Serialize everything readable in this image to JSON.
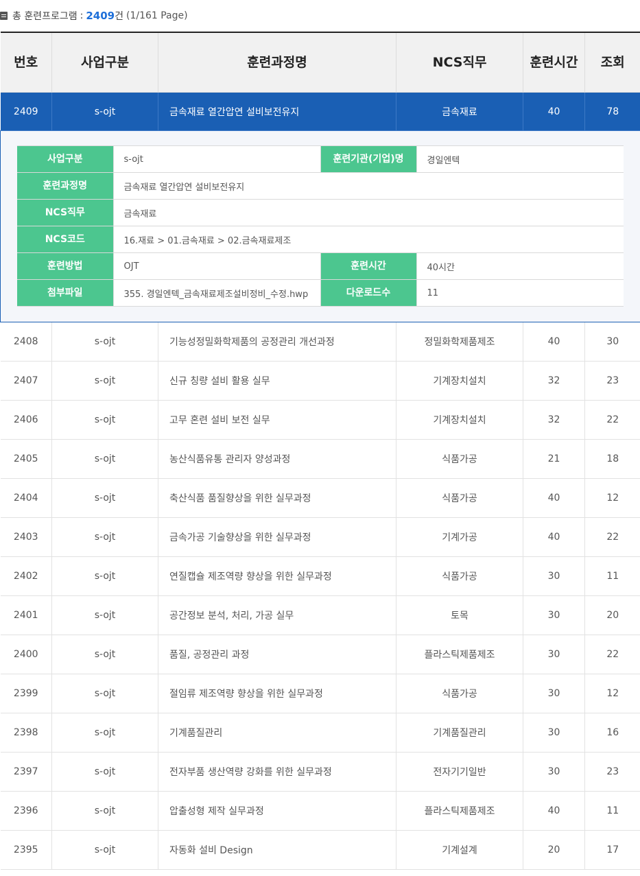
{
  "summary": {
    "label": "총 훈련프로그램",
    "separator": ":",
    "count": "2409",
    "unit": "건",
    "page_info": "(1/161 Page)"
  },
  "table": {
    "headers": {
      "no": "번호",
      "biz": "사업구분",
      "course": "훈련과정명",
      "ncs": "NCS직무",
      "hours": "훈련시간",
      "views": "조회"
    },
    "selected_row": {
      "no": "2409",
      "biz": "s-ojt",
      "course": "금속재료 열간압연 설비보전유지",
      "ncs": "금속재료",
      "hours": "40",
      "views": "78"
    },
    "detail": {
      "biz_label": "사업구분",
      "biz_value": "s-ojt",
      "org_label": "훈련기관(기업)명",
      "org_value": "경일엔텍",
      "course_label": "훈련과정명",
      "course_value": "금속재료 열간압연 설비보전유지",
      "ncs_job_label": "NCS직무",
      "ncs_job_value": "금속재료",
      "ncs_code_label": "NCS코드",
      "ncs_code_value": "16.재료 > 01.금속재료 > 02.금속재료제조",
      "method_label": "훈련방법",
      "method_value": "OJT",
      "hours_label": "훈련시간",
      "hours_value": "40시간",
      "file_label": "첨부파일",
      "file_value": "355. 경일엔텍_금속재료제조설비정비_수정.hwp",
      "downloads_label": "다운로드수",
      "downloads_value": "11"
    },
    "rows": [
      {
        "no": "2408",
        "biz": "s-ojt",
        "course": "기능성정밀화학제품의 공정관리 개선과정",
        "ncs": "정밀화학제품제조",
        "hours": "40",
        "views": "30"
      },
      {
        "no": "2407",
        "biz": "s-ojt",
        "course": "신규 칭량 설비 활용 실무",
        "ncs": "기계장치설치",
        "hours": "32",
        "views": "23"
      },
      {
        "no": "2406",
        "biz": "s-ojt",
        "course": "고무 혼련 설비 보전 실무",
        "ncs": "기계장치설치",
        "hours": "32",
        "views": "22"
      },
      {
        "no": "2405",
        "biz": "s-ojt",
        "course": "농산식품유통 관리자 양성과정",
        "ncs": "식품가공",
        "hours": "21",
        "views": "18"
      },
      {
        "no": "2404",
        "biz": "s-ojt",
        "course": "축산식품 품질향상을 위한 실무과정",
        "ncs": "식품가공",
        "hours": "40",
        "views": "12"
      },
      {
        "no": "2403",
        "biz": "s-ojt",
        "course": "금속가공 기술향상을 위한 실무과정",
        "ncs": "기계가공",
        "hours": "40",
        "views": "22"
      },
      {
        "no": "2402",
        "biz": "s-ojt",
        "course": "연질캡슐 제조역량 향상을 위한 실무과정",
        "ncs": "식품가공",
        "hours": "30",
        "views": "11"
      },
      {
        "no": "2401",
        "biz": "s-ojt",
        "course": "공간정보 분석, 처리, 가공 실무",
        "ncs": "토목",
        "hours": "30",
        "views": "20"
      },
      {
        "no": "2400",
        "biz": "s-ojt",
        "course": "품질, 공정관리 과정",
        "ncs": "플라스틱제품제조",
        "hours": "30",
        "views": "22"
      },
      {
        "no": "2399",
        "biz": "s-ojt",
        "course": "절임류 제조역량 향상을 위한 실무과정",
        "ncs": "식품가공",
        "hours": "30",
        "views": "12"
      },
      {
        "no": "2398",
        "biz": "s-ojt",
        "course": "기계품질관리",
        "ncs": "기계품질관리",
        "hours": "30",
        "views": "16"
      },
      {
        "no": "2397",
        "biz": "s-ojt",
        "course": "전자부품 생산역량 강화를 위한 실무과정",
        "ncs": "전자기기일반",
        "hours": "30",
        "views": "23"
      },
      {
        "no": "2396",
        "biz": "s-ojt",
        "course": "압출성형 제작 실무과정",
        "ncs": "플라스틱제품제조",
        "hours": "40",
        "views": "11"
      },
      {
        "no": "2395",
        "biz": "s-ojt",
        "course": "자동화 설비 Design",
        "ncs": "기계설계",
        "hours": "20",
        "views": "17"
      }
    ]
  }
}
